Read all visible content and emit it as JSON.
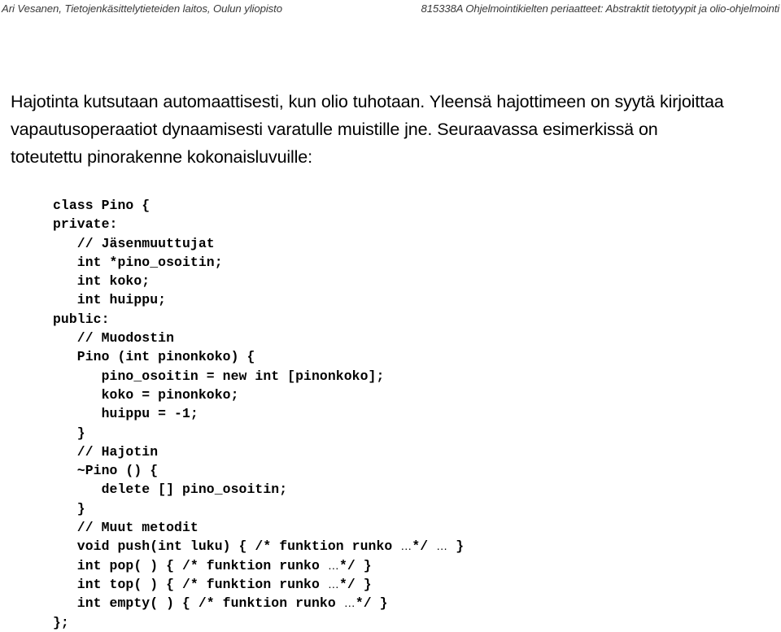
{
  "header": {
    "left": "Ari Vesanen, Tietojenkäsittelytieteiden laitos, Oulun yliopisto",
    "right": "815338A Ohjelmointikielten periaatteet: Abstraktit tietotyypit ja olio-ohjelmointi"
  },
  "body": {
    "paragraph": "Hajotinta kutsutaan automaattisesti, kun olio tuhotaan. Yleensä hajottimeen on syytä kirjoittaa vapautusoperaatiot dynaamisesti varatulle muistille jne. Seuraavassa esimerkissä on toteutettu pinorakenne kokonaisluvuille:"
  },
  "code": {
    "language": "C++",
    "lines": [
      "class Pino {",
      "private:",
      "   // Jäsenmuuttujat",
      "   int *pino_osoitin;",
      "   int koko;",
      "   int huippu;",
      "public:",
      "   // Muodostin",
      "   Pino (int pinonkoko) {",
      "      pino_osoitin = new int [pinonkoko];",
      "      koko = pinonkoko;",
      "      huippu = -1;",
      "   }",
      "   // Hajotin",
      "   ~Pino () {",
      "      delete [] pino_osoitin;",
      "   }",
      "   // Muut metodit",
      "   void push(int luku) { /* funktion runko …*/ … }",
      "   int pop( ) { /* funktion runko …*/ }",
      "   int top( ) { /* funktion runko …*/ }",
      "   int empty( ) { /* funktion runko …*/ }",
      "};"
    ]
  },
  "colors": {
    "background": "#ffffff",
    "text": "#000000",
    "header_text": "#3a3a3a"
  }
}
